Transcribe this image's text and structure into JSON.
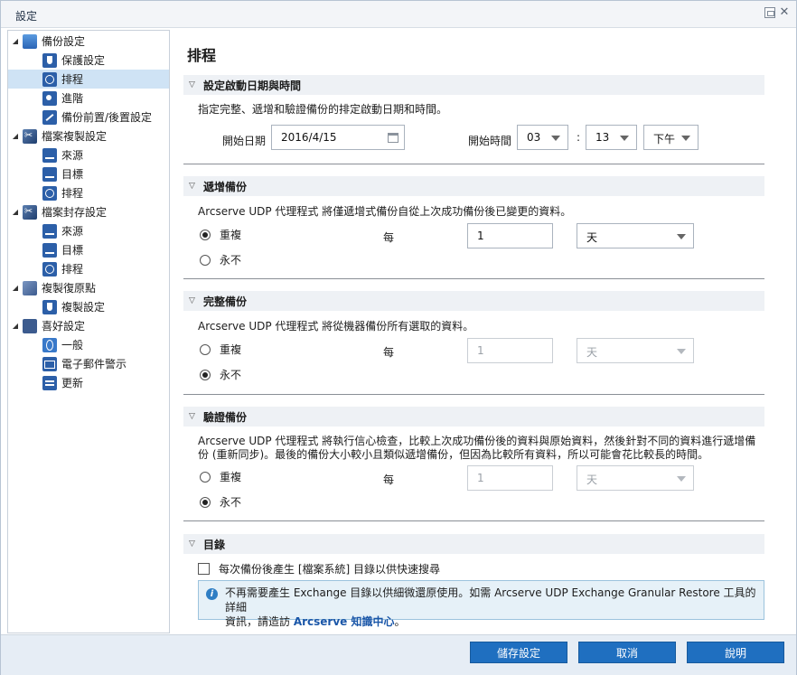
{
  "window": {
    "title": "設定"
  },
  "tree": [
    {
      "label": "備份設定",
      "level": 0,
      "toggle": "◢",
      "icon": "backup-icon",
      "selected": false
    },
    {
      "label": "保護設定",
      "level": 1,
      "icon": "shield-icon",
      "selected": false
    },
    {
      "label": "排程",
      "level": 1,
      "icon": "clock-icon",
      "selected": true
    },
    {
      "label": "進階",
      "level": 1,
      "icon": "gear-icon",
      "selected": false
    },
    {
      "label": "備份前置/後置設定",
      "level": 1,
      "icon": "wrench-icon",
      "selected": false
    },
    {
      "label": "檔案複製設定",
      "level": 0,
      "toggle": "◢",
      "icon": "file-copy-icon",
      "selected": false
    },
    {
      "label": "來源",
      "level": 1,
      "icon": "network-icon",
      "selected": false
    },
    {
      "label": "目標",
      "level": 1,
      "icon": "network-icon",
      "selected": false
    },
    {
      "label": "排程",
      "level": 1,
      "icon": "clock-icon",
      "selected": false
    },
    {
      "label": "檔案封存設定",
      "level": 0,
      "toggle": "◢",
      "icon": "file-archive-icon",
      "selected": false
    },
    {
      "label": "來源",
      "level": 1,
      "icon": "network-icon",
      "selected": false
    },
    {
      "label": "目標",
      "level": 1,
      "icon": "network-icon",
      "selected": false
    },
    {
      "label": "排程",
      "level": 1,
      "icon": "clock-icon",
      "selected": false
    },
    {
      "label": "複製復原點",
      "level": 0,
      "toggle": "◢",
      "icon": "replicate-icon",
      "selected": false
    },
    {
      "label": "複製設定",
      "level": 1,
      "icon": "shield-icon",
      "selected": false
    },
    {
      "label": "喜好設定",
      "level": 0,
      "toggle": "◢",
      "icon": "preferences-icon",
      "selected": false
    },
    {
      "label": "一般",
      "level": 1,
      "icon": "globe-icon",
      "selected": false
    },
    {
      "label": "電子郵件警示",
      "level": 1,
      "icon": "mail-icon",
      "selected": false
    },
    {
      "label": "更新",
      "level": 1,
      "icon": "update-icon",
      "selected": false
    }
  ],
  "main": {
    "title": "排程",
    "start": {
      "header": "設定啟動日期與時間",
      "desc": "指定完整、遞增和驗證備份的排定啟動日期和時間。",
      "date_label": "開始日期",
      "date_value": "2016/4/15",
      "time_label": "開始時間",
      "hour": "03",
      "colon": ":",
      "minute": "13",
      "ampm": "下午"
    },
    "incremental": {
      "header": "遞增備份",
      "desc": "Arcserve UDP 代理程式 將僅遞增式備份自從上次成功備份後已變更的資料。",
      "repeat": "重複",
      "never": "永不",
      "every": "每",
      "value": "1",
      "unit": "天"
    },
    "full": {
      "header": "完整備份",
      "desc": "Arcserve UDP 代理程式 將從機器備份所有選取的資料。",
      "repeat": "重複",
      "never": "永不",
      "every": "每",
      "value": "1",
      "unit": "天"
    },
    "verify": {
      "header": "驗證備份",
      "desc_line1": "Arcserve UDP 代理程式 將執行信心檢查，比較上次成功備份後的資料與原始資料，然後針對不同的資料進行遞增備",
      "desc_line2": "份 (重新同步)。最後的備份大小較小且類似遞增備份，但因為比較所有資料，所以可能會花比較長的時間。",
      "repeat": "重複",
      "never": "永不",
      "every": "每",
      "value": "1",
      "unit": "天"
    },
    "catalog": {
      "header": "目錄",
      "checkbox_label": "每次備份後產生 [檔案系統] 目錄以供快速搜尋",
      "info_text1": "不再需要產生 Exchange 目錄以供細微還原使用。如需 Arcserve UDP Exchange Granular Restore 工具的詳細",
      "info_text2": "資訊，請造訪 ",
      "info_link": "Arcserve 知識中心",
      "info_text3": "。"
    }
  },
  "footer": {
    "save": "儲存設定",
    "cancel": "取消",
    "help": "說明"
  }
}
